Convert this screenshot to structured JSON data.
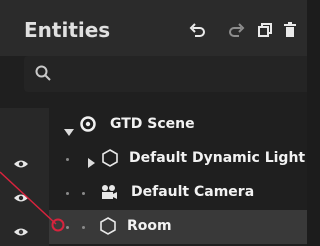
{
  "panel": {
    "title": "Entities",
    "toolbar": {
      "undo_icon": "undo-icon",
      "redo_icon": "redo-icon",
      "duplicate_icon": "duplicate-icon",
      "delete_icon": "trash-icon"
    },
    "search": {
      "placeholder": "",
      "value": ""
    }
  },
  "tree": {
    "rows": [
      {
        "label": "GTD Scene",
        "icon": "scene-target-icon",
        "expanded": true,
        "visible_eye": false
      },
      {
        "label": "Default Dynamic Light",
        "icon": "hexagon-entity-icon",
        "expanded": false,
        "visible_eye": true
      },
      {
        "label": "Default Camera",
        "icon": "camera-icon",
        "visible_eye": true
      },
      {
        "label": "Room",
        "icon": "hexagon-entity-icon",
        "visible_eye": true,
        "selected": true
      }
    ]
  },
  "annotation": {
    "color": "#d8233d"
  }
}
